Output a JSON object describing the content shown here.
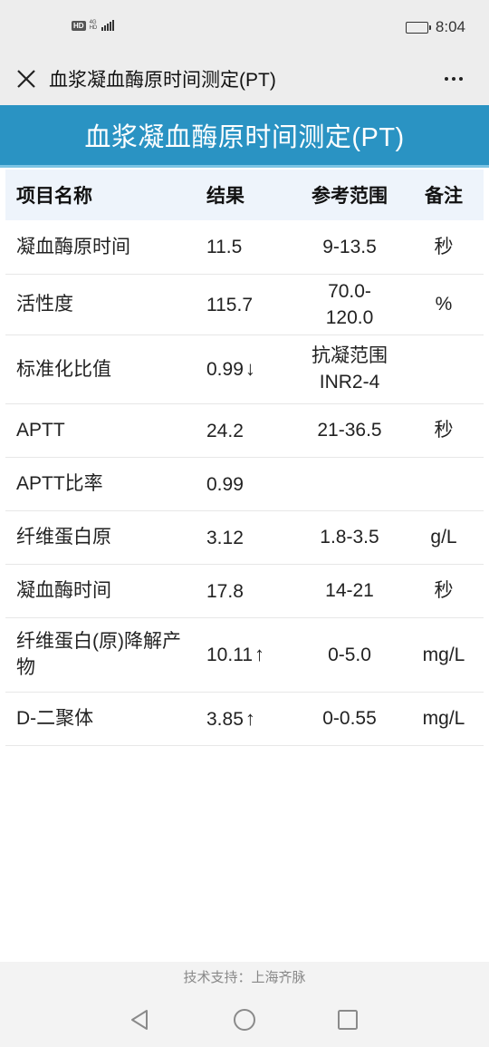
{
  "status_bar": {
    "hd": "HD",
    "network_top": "4G",
    "network_bottom": "HD",
    "time": "8:04"
  },
  "nav": {
    "title": "血浆凝血酶原时间测定(PT)"
  },
  "page": {
    "header_title": "血浆凝血酶原时间测定(PT)"
  },
  "table": {
    "headers": [
      "项目名称",
      "结果",
      "参考范围",
      "备注"
    ],
    "rows": [
      {
        "name": "凝血酶原时间",
        "result": "11.5",
        "arrow": "",
        "range": "9-13.5",
        "note": "秒"
      },
      {
        "name": "活性度",
        "result": "115.7",
        "arrow": "",
        "range": "70.0-120.0",
        "note": "%"
      },
      {
        "name": "标准化比值",
        "result": "0.99",
        "arrow": "↓",
        "range": "抗凝范围INR2-4",
        "note": ""
      },
      {
        "name": "APTT",
        "result": "24.2",
        "arrow": "",
        "range": "21-36.5",
        "note": "秒"
      },
      {
        "name": "APTT比率",
        "result": "0.99",
        "arrow": "",
        "range": "",
        "note": ""
      },
      {
        "name": "纤维蛋白原",
        "result": "3.12",
        "arrow": "",
        "range": "1.8-3.5",
        "note": "g/L"
      },
      {
        "name": "凝血酶时间",
        "result": "17.8",
        "arrow": "",
        "range": "14-21",
        "note": "秒"
      },
      {
        "name": "纤维蛋白(原)降解产物",
        "result": "10.11",
        "arrow": "↑",
        "range": "0-5.0",
        "note": "mg/L"
      },
      {
        "name": "D-二聚体",
        "result": "3.85",
        "arrow": "↑",
        "range": "0-0.55",
        "note": "mg/L"
      }
    ]
  },
  "footer": {
    "text": "技术支持：上海齐脉"
  },
  "colors": {
    "header_bg": "#2a93c3",
    "table_head_bg": "#eef4fb",
    "chrome_bg": "#ededed"
  },
  "icons": {
    "close": "close-icon",
    "more": "more-icon",
    "back": "back-triangle-icon",
    "home": "home-circle-icon",
    "recents": "recents-square-icon"
  }
}
